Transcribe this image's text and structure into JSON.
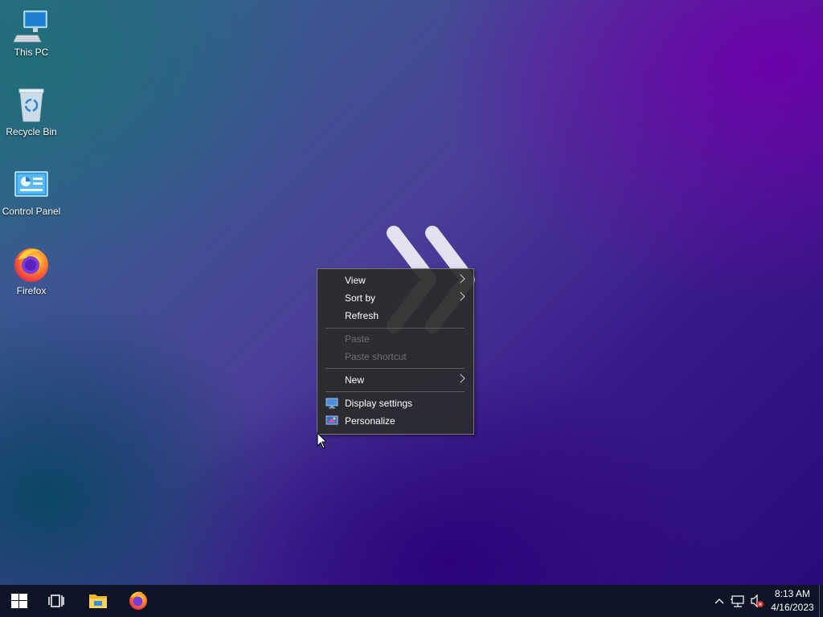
{
  "desktop": {
    "icons": [
      {
        "label": "This PC",
        "icon": "this-pc-icon"
      },
      {
        "label": "Recycle Bin",
        "icon": "recycle-bin-icon"
      },
      {
        "label": "Control Panel",
        "icon": "control-panel-icon"
      },
      {
        "label": "Firefox",
        "icon": "firefox-icon"
      }
    ]
  },
  "context_menu": {
    "items": [
      {
        "label": "View",
        "enabled": true,
        "submenu": true
      },
      {
        "label": "Sort by",
        "enabled": true,
        "submenu": true
      },
      {
        "label": "Refresh",
        "enabled": true,
        "submenu": false
      },
      {
        "label": "Paste",
        "enabled": false,
        "submenu": false
      },
      {
        "label": "Paste shortcut",
        "enabled": false,
        "submenu": false
      },
      {
        "label": "New",
        "enabled": true,
        "submenu": true
      },
      {
        "label": "Display settings",
        "enabled": true,
        "submenu": false,
        "icon": "display-icon"
      },
      {
        "label": "Personalize",
        "enabled": true,
        "submenu": false,
        "icon": "personalize-icon"
      }
    ]
  },
  "taskbar": {
    "start_icon": "windows-logo-icon",
    "task_view_icon": "task-view-icon",
    "pinned": [
      {
        "name": "File Explorer",
        "icon": "file-explorer-icon"
      },
      {
        "name": "Firefox",
        "icon": "firefox-icon"
      }
    ],
    "tray": {
      "icons": [
        "chevron-up-icon",
        "network-icon",
        "volume-muted-icon"
      ],
      "time": "8:13 AM",
      "date": "4/16/2023"
    }
  },
  "colors": {
    "taskbar_bg": "#0d1426",
    "menu_bg": "#2b2b2b",
    "menu_text": "#ffffff",
    "menu_disabled_text": "#6f6f6f",
    "accent": "#0078d7"
  }
}
